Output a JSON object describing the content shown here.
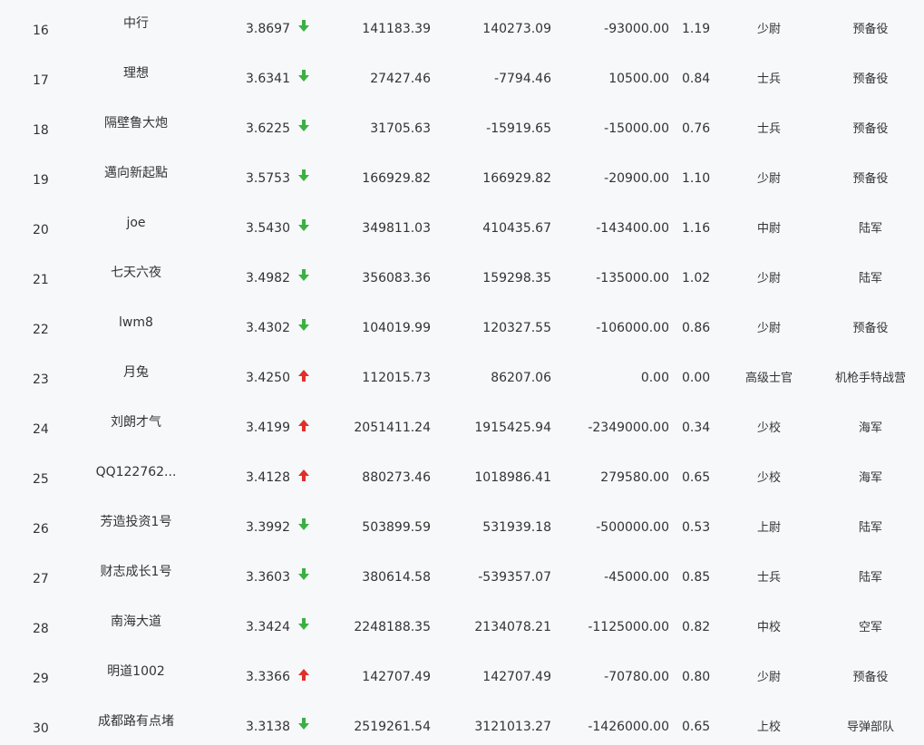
{
  "colors": {
    "background": "#f7f8fa",
    "text": "#333333",
    "arrow_down": "#3cb043",
    "arrow_up": "#e0302a"
  },
  "rows": [
    {
      "rank": "16",
      "name": "中行",
      "value": "3.8697",
      "trend": "down",
      "icon": "arrow-down-icon",
      "c1": "141183.39",
      "c2": "140273.09",
      "c3": "-93000.00",
      "ratio": "1.19",
      "rank_title": "少尉",
      "corps": "预备役"
    },
    {
      "rank": "17",
      "name": "理想",
      "value": "3.6341",
      "trend": "down",
      "icon": "arrow-down-icon",
      "c1": "27427.46",
      "c2": "-7794.46",
      "c3": "10500.00",
      "ratio": "0.84",
      "rank_title": "士兵",
      "corps": "预备役"
    },
    {
      "rank": "18",
      "name": "隔壁鲁大炮",
      "value": "3.6225",
      "trend": "down",
      "icon": "arrow-down-icon",
      "c1": "31705.63",
      "c2": "-15919.65",
      "c3": "-15000.00",
      "ratio": "0.76",
      "rank_title": "士兵",
      "corps": "预备役"
    },
    {
      "rank": "19",
      "name": "邁向新起點",
      "value": "3.5753",
      "trend": "down",
      "icon": "arrow-down-icon",
      "c1": "166929.82",
      "c2": "166929.82",
      "c3": "-20900.00",
      "ratio": "1.10",
      "rank_title": "少尉",
      "corps": "预备役"
    },
    {
      "rank": "20",
      "name": "joe",
      "value": "3.5430",
      "trend": "down",
      "icon": "arrow-down-icon",
      "c1": "349811.03",
      "c2": "410435.67",
      "c3": "-143400.00",
      "ratio": "1.16",
      "rank_title": "中尉",
      "corps": "陆军"
    },
    {
      "rank": "21",
      "name": "七天六夜",
      "value": "3.4982",
      "trend": "down",
      "icon": "arrow-down-icon",
      "c1": "356083.36",
      "c2": "159298.35",
      "c3": "-135000.00",
      "ratio": "1.02",
      "rank_title": "少尉",
      "corps": "陆军"
    },
    {
      "rank": "22",
      "name": "lwm8",
      "value": "3.4302",
      "trend": "down",
      "icon": "arrow-down-icon",
      "c1": "104019.99",
      "c2": "120327.55",
      "c3": "-106000.00",
      "ratio": "0.86",
      "rank_title": "少尉",
      "corps": "预备役"
    },
    {
      "rank": "23",
      "name": "月兔",
      "value": "3.4250",
      "trend": "up",
      "icon": "arrow-up-icon",
      "c1": "112015.73",
      "c2": "86207.06",
      "c3": "0.00",
      "ratio": "0.00",
      "rank_title": "高级士官",
      "corps": "机枪手特战营"
    },
    {
      "rank": "24",
      "name": "刘朗才气",
      "value": "3.4199",
      "trend": "up",
      "icon": "arrow-up-icon",
      "c1": "2051411.24",
      "c2": "1915425.94",
      "c3": "-2349000.00",
      "ratio": "0.34",
      "rank_title": "少校",
      "corps": "海军"
    },
    {
      "rank": "25",
      "name": "QQ122762...",
      "value": "3.4128",
      "trend": "up",
      "icon": "arrow-up-icon",
      "c1": "880273.46",
      "c2": "1018986.41",
      "c3": "279580.00",
      "ratio": "0.65",
      "rank_title": "少校",
      "corps": "海军"
    },
    {
      "rank": "26",
      "name": "芳造投资1号",
      "value": "3.3992",
      "trend": "down",
      "icon": "arrow-down-icon",
      "c1": "503899.59",
      "c2": "531939.18",
      "c3": "-500000.00",
      "ratio": "0.53",
      "rank_title": "上尉",
      "corps": "陆军"
    },
    {
      "rank": "27",
      "name": "财志成长1号",
      "value": "3.3603",
      "trend": "down",
      "icon": "arrow-down-icon",
      "c1": "380614.58",
      "c2": "-539357.07",
      "c3": "-45000.00",
      "ratio": "0.85",
      "rank_title": "士兵",
      "corps": "陆军"
    },
    {
      "rank": "28",
      "name": "南海大道",
      "value": "3.3424",
      "trend": "down",
      "icon": "arrow-down-icon",
      "c1": "2248188.35",
      "c2": "2134078.21",
      "c3": "-1125000.00",
      "ratio": "0.82",
      "rank_title": "中校",
      "corps": "空军"
    },
    {
      "rank": "29",
      "name": "明道1002",
      "value": "3.3366",
      "trend": "up",
      "icon": "arrow-up-icon",
      "c1": "142707.49",
      "c2": "142707.49",
      "c3": "-70780.00",
      "ratio": "0.80",
      "rank_title": "少尉",
      "corps": "预备役"
    },
    {
      "rank": "30",
      "name": "成都路有点堵",
      "value": "3.3138",
      "trend": "down",
      "icon": "arrow-down-icon",
      "c1": "2519261.54",
      "c2": "3121013.27",
      "c3": "-1426000.00",
      "ratio": "0.65",
      "rank_title": "上校",
      "corps": "导弹部队"
    }
  ]
}
